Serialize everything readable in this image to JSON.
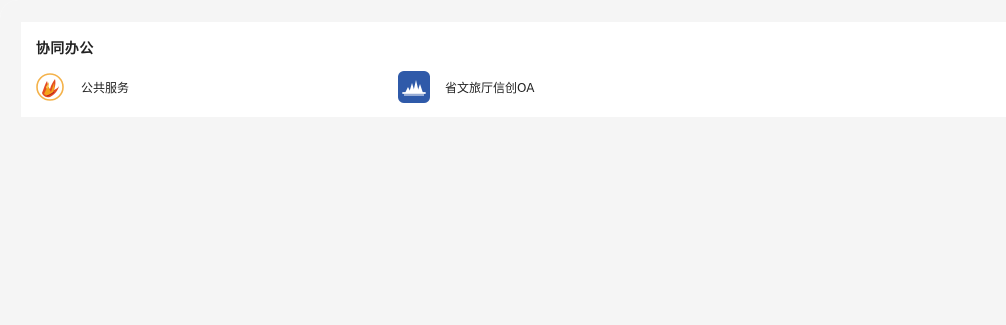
{
  "section": {
    "title": "协同办公"
  },
  "apps": [
    {
      "label": "公共服务",
      "icon": "public-service-logo-icon",
      "colors": {
        "primary": "#e44b22",
        "secondary": "#f3a31c",
        "accent": "#f8c24d"
      }
    },
    {
      "label": "省文旅厅信创OA",
      "icon": "building-logo-icon",
      "colors": {
        "primary": "#2f5aa9",
        "secondary": "#ffffff"
      }
    }
  ]
}
